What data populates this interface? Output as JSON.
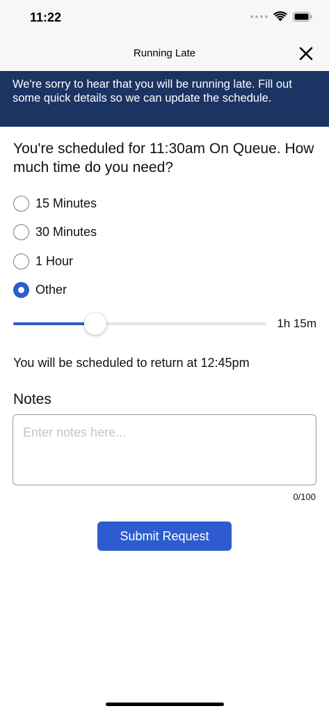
{
  "status_bar": {
    "time": "11:22",
    "icons": [
      "cellular-icon",
      "wifi-icon",
      "battery-icon"
    ]
  },
  "nav": {
    "title": "Running Late",
    "close_icon": "close-icon"
  },
  "banner": {
    "text": "We're sorry to hear that you will be running late. Fill out some quick details so we can update the schedule.",
    "background": "#1b3464"
  },
  "question": {
    "text": "You're scheduled for 11:30am On Queue. How much time do you need?"
  },
  "time_options": [
    {
      "label": "15 Minutes",
      "selected": false
    },
    {
      "label": "30 Minutes",
      "selected": false
    },
    {
      "label": "1 Hour",
      "selected": false
    },
    {
      "label": "Other",
      "selected": true
    }
  ],
  "slider": {
    "fraction": 0.325,
    "value_label": "1h 15m"
  },
  "return_text": "You will be scheduled to return at 12:45pm",
  "notes": {
    "label": "Notes",
    "placeholder": "Enter notes here...",
    "value": "",
    "char_count": "0/100"
  },
  "submit": {
    "label": "Submit Request"
  },
  "colors": {
    "accent": "#2d5ccf",
    "banner": "#1b3464"
  }
}
